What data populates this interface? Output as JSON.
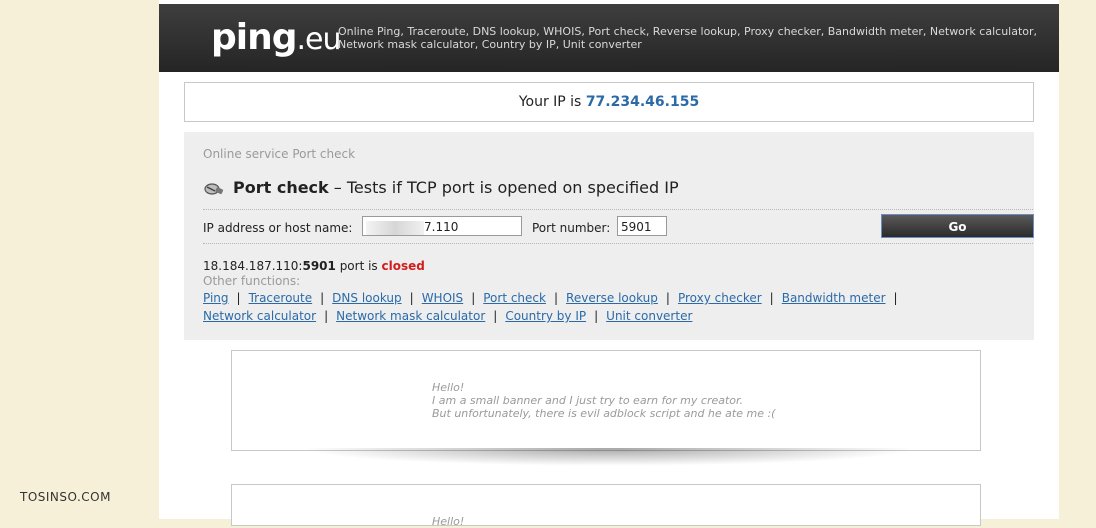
{
  "header": {
    "logo_main": "ping",
    "logo_tld": ".eu",
    "tagline": "Online Ping, Traceroute, DNS lookup, WHOIS, Port check, Reverse lookup, Proxy checker, Bandwidth meter, Network calculator, Network mask calculator, Country by IP, Unit converter"
  },
  "ip_box": {
    "label": "Your IP is",
    "ip": "77.234.46.155"
  },
  "service": {
    "caption": "Online service Port check",
    "title": "Port check",
    "subtitle": "– Tests if TCP port is opened on specified IP",
    "icon": "port-plug-icon"
  },
  "form": {
    "host_label": "IP address or host name:",
    "host_value_visible": "7.110",
    "port_label": "Port number:",
    "port_value": "5901",
    "go_label": "Go"
  },
  "result": {
    "host": "18.184.187.110:",
    "port": "5901",
    "text": " port is ",
    "status": "closed"
  },
  "other_functions": {
    "label": "Other functions:",
    "links": [
      "Ping",
      "Traceroute",
      "DNS lookup",
      "WHOIS",
      "Port check",
      "Reverse lookup",
      "Proxy checker",
      "Bandwidth meter",
      "Network calculator",
      "Network mask calculator",
      "Country by IP",
      "Unit converter"
    ]
  },
  "banner": {
    "line1": "Hello!",
    "line2": "I am a small banner and I just try to earn for my creator.",
    "line3": "But unfortunately, there is evil adblock script and he ate me :(",
    "partial": "Hello!"
  },
  "watermark": "TOSINSO.COM",
  "colors": {
    "link": "#2b6aa8",
    "closed": "#d21d1d",
    "header_bg": "#2f2f2f",
    "page_bg": "#f7f0d8"
  }
}
